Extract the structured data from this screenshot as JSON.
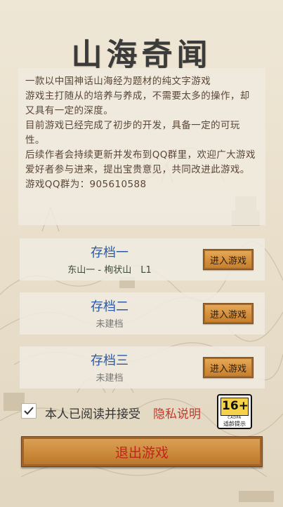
{
  "title": "山海奇闻",
  "intro": {
    "lines": [
      "一款以中国神话山海经为题材的纯文字游戏",
      "游戏主打随从的培养与养成，不需要太多的操作，却又具有一定的深度。",
      "目前游戏已经完成了初步的开发，具备一定的可玩性。",
      "后续作者会持续更新并发布到QQ群里，欢迎广大游戏爱好者参与进来，提出宝贵意见，共同改进此游戏。",
      "游戏QQ群为：905610588"
    ]
  },
  "save_slots": [
    {
      "name": "存档一",
      "status": "东山一 - 栒状山　L1",
      "button_label": "进入游戏"
    },
    {
      "name": "存档二",
      "status": "未建档",
      "button_label": "进入游戏"
    },
    {
      "name": "存档三",
      "status": "未建档",
      "button_label": "进入游戏"
    }
  ],
  "agreement": {
    "checked": true,
    "text": "本人已阅读并接受",
    "privacy_link": "隐私说明"
  },
  "age_rating": {
    "number": "16+",
    "org": "CADPA",
    "label": "适龄提示"
  },
  "exit_button": "退出游戏",
  "colors": {
    "slot_name": "#2b5aa3",
    "privacy_link": "#c0392b",
    "exit_text": "#c0251c",
    "button_wood": "#d48f3c"
  }
}
